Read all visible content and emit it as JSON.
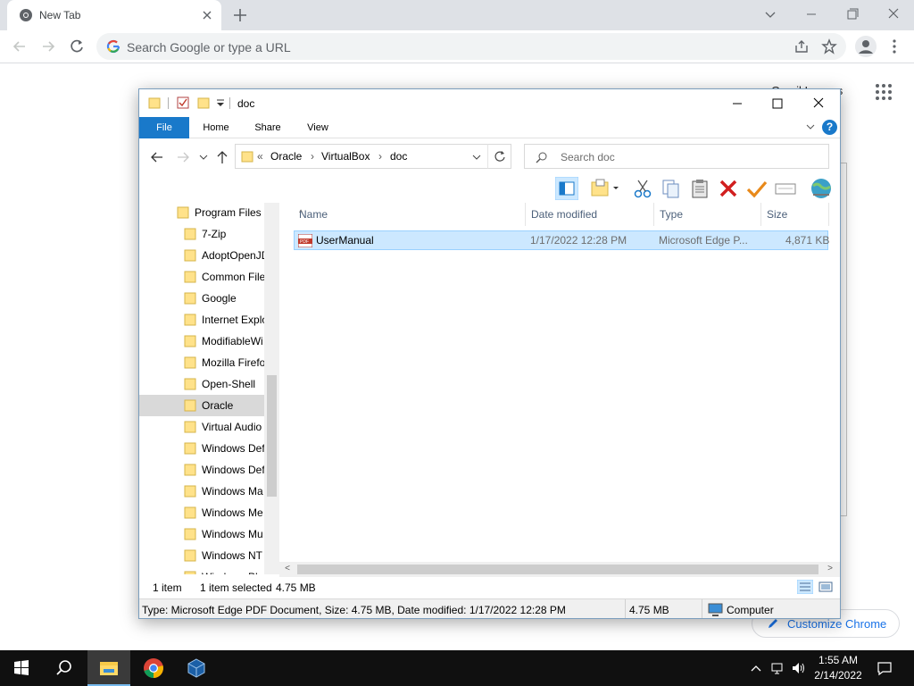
{
  "chrome": {
    "tab_title": "New Tab",
    "omnibox_placeholder": "Search Google or type a URL",
    "ntp_links": "Gmail  Images",
    "customize_label": "Customize Chrome"
  },
  "explorer": {
    "title": "doc",
    "ribbon_tabs": [
      "File",
      "Home",
      "Share",
      "View"
    ],
    "breadcrumb": {
      "prefix": "«",
      "items": [
        "Oracle",
        "VirtualBox",
        "doc"
      ]
    },
    "search_placeholder": "Search doc",
    "nav_items": [
      {
        "label": "Program Files",
        "selected": false
      },
      {
        "label": "7-Zip",
        "selected": false
      },
      {
        "label": "AdoptOpenJD",
        "selected": false
      },
      {
        "label": "Common File",
        "selected": false
      },
      {
        "label": "Google",
        "selected": false
      },
      {
        "label": "Internet Explo",
        "selected": false
      },
      {
        "label": "ModifiableWi",
        "selected": false
      },
      {
        "label": "Mozilla Firefo",
        "selected": false
      },
      {
        "label": "Open-Shell",
        "selected": false
      },
      {
        "label": "Oracle",
        "selected": true
      },
      {
        "label": "Virtual Audio",
        "selected": false
      },
      {
        "label": "Windows Def",
        "selected": false
      },
      {
        "label": "Windows Def",
        "selected": false
      },
      {
        "label": "Windows Ma",
        "selected": false
      },
      {
        "label": "Windows Me",
        "selected": false
      },
      {
        "label": "Windows Mu",
        "selected": false
      },
      {
        "label": "Windows NT",
        "selected": false
      },
      {
        "label": "Windows Pho",
        "selected": false
      }
    ],
    "columns": [
      "Name",
      "Date modified",
      "Type",
      "Size"
    ],
    "files": [
      {
        "name": "UserManual",
        "date_modified": "1/17/2022 12:28 PM",
        "type": "Microsoft Edge P...",
        "size": "4,871 KB",
        "icon": "pdf-icon",
        "selected": true
      }
    ],
    "status": {
      "item_count": "1 item",
      "selected": "1 item selected",
      "selected_size": "4.75 MB"
    },
    "details": {
      "info": "Type: Microsoft Edge PDF Document, Size: 4.75 MB, Date modified: 1/17/2022 12:28 PM",
      "size": "4.75 MB",
      "location": "Computer"
    },
    "colors": {
      "file_tab": "#1979ca",
      "selection": "#cce8ff",
      "selection_border": "#99d1ff"
    }
  },
  "taskbar": {
    "time": "1:55 AM",
    "date": "2/14/2022",
    "apps": [
      "windows-start-icon",
      "search-icon",
      "file-explorer-icon",
      "chrome-icon",
      "virtualbox-icon"
    ]
  }
}
